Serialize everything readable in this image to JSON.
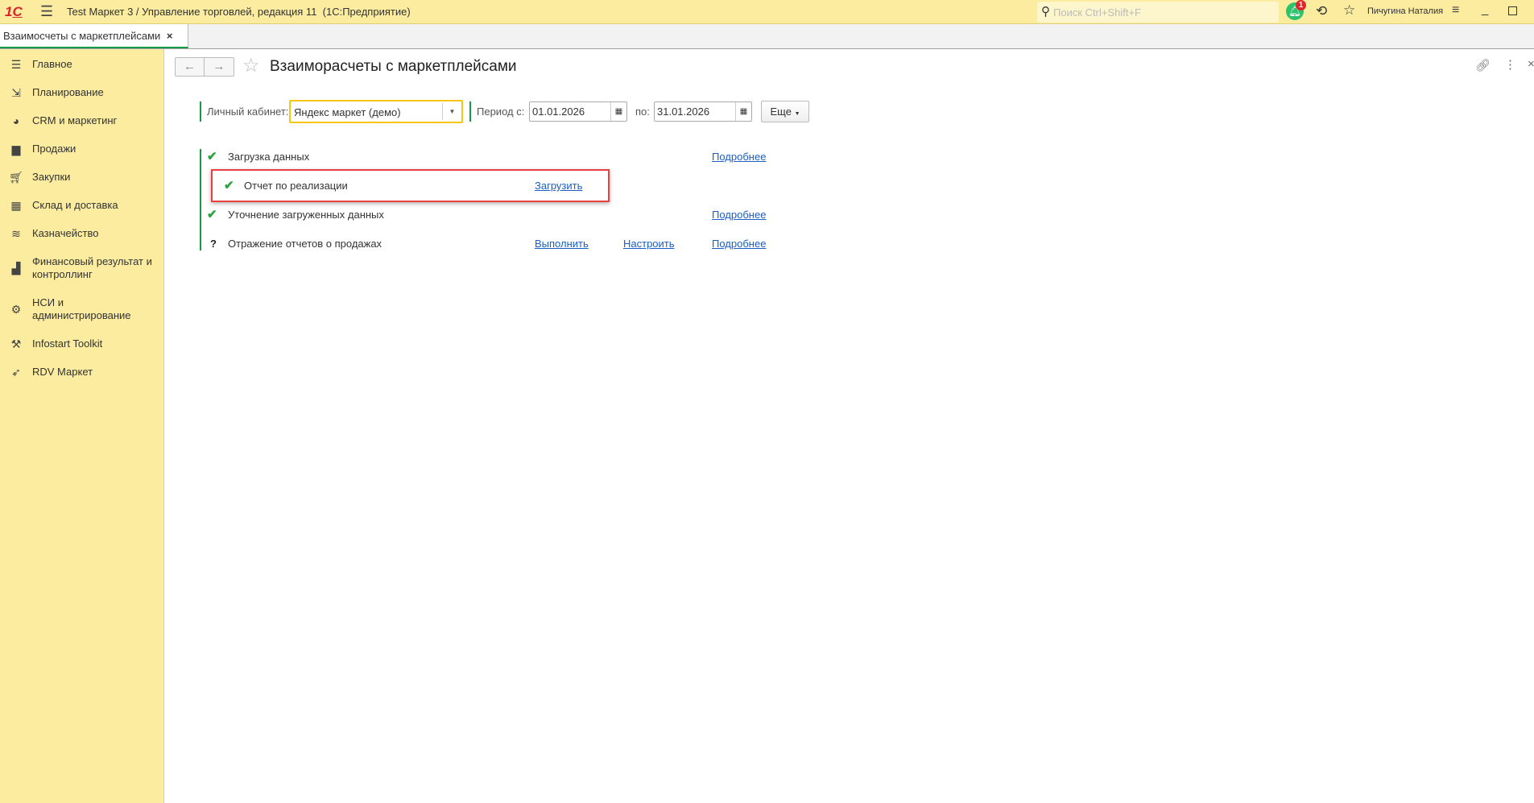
{
  "app": {
    "title": "Test Маркет 3 / Управление торговлей, редакция 11  (1С:Предприятие)",
    "search_placeholder": "Поиск Ctrl+Shift+F",
    "notification_count": "1",
    "user": "Пичугина Наталия"
  },
  "tabs": [
    {
      "label": "Взаимосчеты с маркетплейсами"
    }
  ],
  "sidebar": {
    "items": [
      {
        "label": "Главное",
        "icon": "menu-icon"
      },
      {
        "label": "Планирование",
        "icon": "planning-icon"
      },
      {
        "label": "CRM и маркетинг",
        "icon": "pie-chart-icon"
      },
      {
        "label": "Продажи",
        "icon": "bag-icon"
      },
      {
        "label": "Закупки",
        "icon": "cart-icon"
      },
      {
        "label": "Склад и доставка",
        "icon": "warehouse-icon"
      },
      {
        "label": "Казначейство",
        "icon": "coins-icon"
      },
      {
        "label": "Финансовый результат и контроллинг",
        "icon": "bar-chart-icon"
      },
      {
        "label": "НСИ и администрирование",
        "icon": "gear-icon"
      },
      {
        "label": "Infostart Toolkit",
        "icon": "tools-icon"
      },
      {
        "label": "RDV Маркет",
        "icon": "rocket-icon"
      }
    ]
  },
  "form": {
    "title": "Взаиморасчеты с маркетплейсами",
    "account_label": "Личный кабинет:",
    "account_value": "Яндекс маркет (демо)",
    "period_from_label": "Период с:",
    "period_from": "01.01.2026",
    "period_to_label": "по:",
    "period_to": "31.01.2026",
    "more_label": "Еще",
    "steps": [
      {
        "status": "done",
        "label": "Загрузка данных",
        "links": [
          "Подробнее"
        ]
      },
      {
        "status": "done",
        "label": "Отчет по реализации",
        "links": [
          "Загрузить"
        ]
      },
      {
        "status": "done",
        "label": "Уточнение загруженных данных",
        "links": [
          "Подробнее"
        ]
      },
      {
        "status": "?",
        "label": "Отражение отчетов о продажах",
        "links": [
          "Выполнить",
          "Настроить",
          "Подробнее"
        ]
      }
    ]
  },
  "colors": {
    "accent": "#17994a",
    "highlight": "#e84040",
    "panel": "#fbec9f"
  }
}
